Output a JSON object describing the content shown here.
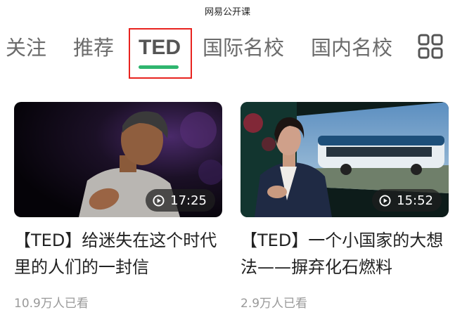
{
  "app": {
    "title": "网易公开课"
  },
  "tabs": [
    {
      "label": "关注"
    },
    {
      "label": "推荐"
    },
    {
      "label": "TED"
    },
    {
      "label": "国际名校"
    },
    {
      "label": "国内名校"
    }
  ],
  "videos": [
    {
      "title": "【TED】给迷失在这个时代里的人们的一封信",
      "duration": "17:25",
      "views": "10.9万人已看"
    },
    {
      "title": "【TED】一个小国家的大想法——摒弃化石燃料",
      "duration": "15:52",
      "views": "2.9万人已看"
    }
  ],
  "colors": {
    "accent": "#2fb56f",
    "highlight_box": "#e8231f"
  }
}
